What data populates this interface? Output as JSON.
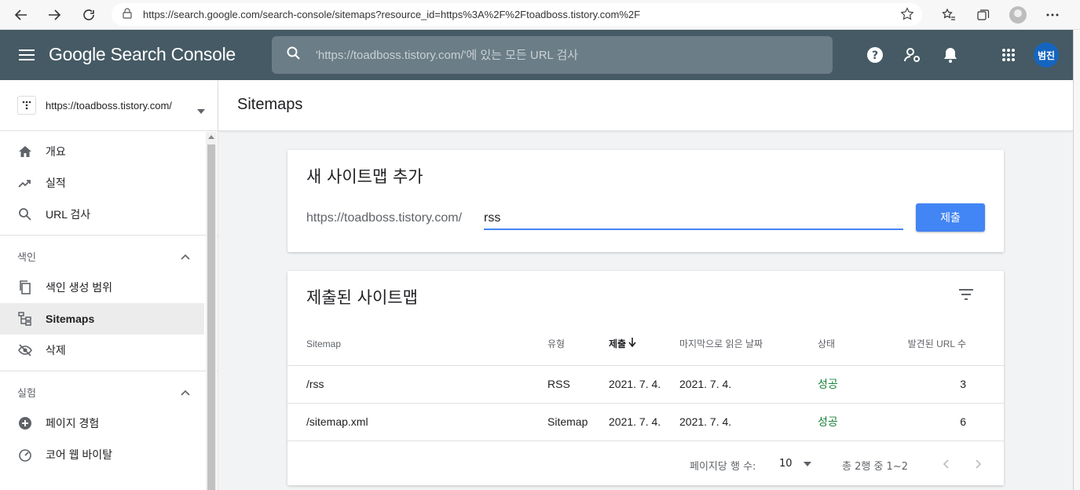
{
  "browser": {
    "url": "https://search.google.com/search-console/sitemaps?resource_id=https%3A%2F%2Ftoadboss.tistory.com%2F"
  },
  "header": {
    "app_title": "Google Search Console",
    "search_placeholder": "'https://toadboss.tistory.com/'에 있는 모든 URL 검사",
    "user_initials": "범진",
    "header_color": "#455a64",
    "avatar_color": "#1565c0"
  },
  "sidebar": {
    "property": "https://toadboss.tistory.com/",
    "nav": [
      {
        "label": "개요",
        "icon": "home-icon"
      },
      {
        "label": "실적",
        "icon": "trending-up-icon"
      },
      {
        "label": "URL 검사",
        "icon": "search-icon"
      }
    ],
    "index_section": {
      "title": "색인",
      "items": [
        {
          "label": "색인 생성 범위",
          "icon": "copy-icon"
        },
        {
          "label": "Sitemaps",
          "icon": "sitemap-icon",
          "active": true
        },
        {
          "label": "삭제",
          "icon": "eye-off-icon"
        }
      ]
    },
    "experience_section": {
      "title": "실험",
      "items": [
        {
          "label": "페이지 경험",
          "icon": "plus-circle-icon"
        },
        {
          "label": "코어 웹 바이탈",
          "icon": "speedometer-icon"
        }
      ]
    }
  },
  "page": {
    "title": "Sitemaps"
  },
  "add_sitemap": {
    "title": "새 사이트맵 추가",
    "prefix": "https://toadboss.tistory.com/",
    "input_value": "rss",
    "submit_label": "제출",
    "accent": "#4285f4"
  },
  "submitted": {
    "title": "제출된 사이트맵",
    "columns": {
      "sitemap": "Sitemap",
      "type": "유형",
      "submitted": "제출",
      "last_read": "마지막으로 읽은 날짜",
      "status": "상태",
      "discovered": "발견된 URL 수"
    },
    "rows": [
      {
        "sitemap": "/rss",
        "type": "RSS",
        "submitted": "2021. 7. 4.",
        "last_read": "2021. 7. 4.",
        "status": "성공",
        "discovered": "3"
      },
      {
        "sitemap": "/sitemap.xml",
        "type": "Sitemap",
        "submitted": "2021. 7. 4.",
        "last_read": "2021. 7. 4.",
        "status": "성공",
        "discovered": "6"
      }
    ],
    "success_color": "#188038",
    "footer": {
      "rows_per_page_label": "페이지당 행 수:",
      "rows_per_page": "10",
      "range": "총 2행 중 1~2"
    }
  }
}
